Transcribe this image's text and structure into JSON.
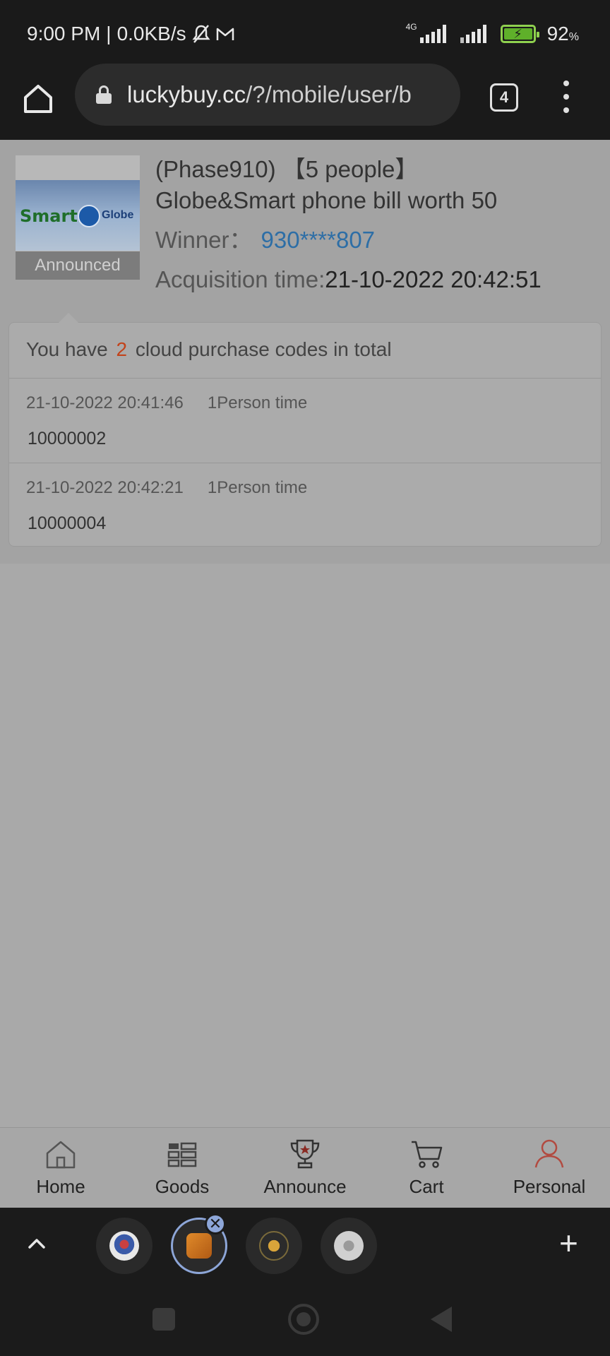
{
  "status_bar": {
    "time": "9:00 PM",
    "speed": "0.0KB/s",
    "network": "4G",
    "battery_pct": "92",
    "battery_unit": "%",
    "icons": [
      "muted-bell-icon",
      "gmail-icon",
      "signal-icon",
      "signal-icon",
      "battery-charging-icon"
    ]
  },
  "browser": {
    "url_domain": "luckybuy.cc",
    "url_path": "/?/mobile/user/b",
    "tab_count": "4"
  },
  "product": {
    "thumbnail_brand_1": "Smart",
    "thumbnail_brand_2": "Globe",
    "thumbnail_badge": "Announced",
    "phase_line": "(Phase910) 【5 people】",
    "title": "Globe&Smart phone bill worth 50",
    "winner_label": "Winner：",
    "winner_value": "930****807",
    "acquisition_label": "Acquisition time:",
    "acquisition_value": "21-10-2022 20:42:51"
  },
  "codes": {
    "head_prefix": "You have",
    "count": "2",
    "head_suffix": "cloud purchase codes in total",
    "rows": [
      {
        "time": "21-10-2022 20:41:46",
        "persons": "1Person time",
        "code": "10000002"
      },
      {
        "time": "21-10-2022 20:42:21",
        "persons": "1Person time",
        "code": "10000004"
      }
    ]
  },
  "bottom_nav": {
    "items": [
      {
        "label": "Home",
        "icon": "home-icon"
      },
      {
        "label": "Goods",
        "icon": "grid-list-icon"
      },
      {
        "label": "Announce",
        "icon": "trophy-icon"
      },
      {
        "label": "Cart",
        "icon": "cart-icon"
      },
      {
        "label": "Personal",
        "icon": "person-icon",
        "active": true
      }
    ]
  },
  "colors": {
    "accent_orange": "#c2431b",
    "link_blue": "#2d6ea6",
    "personal_active": "#c0564b",
    "tab_active_ring": "#8da6d8"
  }
}
